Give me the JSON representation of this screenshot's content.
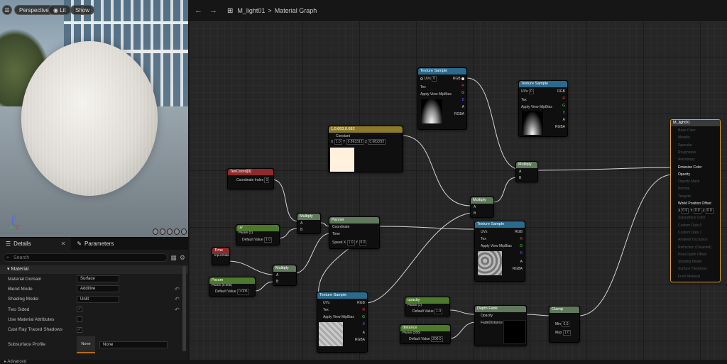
{
  "viewport": {
    "perspective": "Perspective",
    "lit": "Lit",
    "show": "Show"
  },
  "breadcrumb": {
    "asset": "M_light01",
    "separator": ">",
    "graph": "Material Graph"
  },
  "details": {
    "tab_details": "Details",
    "tab_parameters": "Parameters",
    "search_placeholder": "Search",
    "section": "Material",
    "rows": [
      {
        "label": "Material Domain",
        "value": "Surface"
      },
      {
        "label": "Blend Mode",
        "value": "Additive"
      },
      {
        "label": "Shading Model",
        "value": "Unlit"
      },
      {
        "label": "Two Sided",
        "value": "checked"
      },
      {
        "label": "Use Material Attributes",
        "value": ""
      },
      {
        "label": "Cast Ray Traced Shadows",
        "value": "checked"
      },
      {
        "label": "Subsurface Profile",
        "value": "None"
      }
    ],
    "subsurface_thumb": "None",
    "advanced": "Advanced"
  },
  "nodes": {
    "tex_top": {
      "title": "Texture Sample",
      "uvs": "UVs",
      "tex": "Tex",
      "mip": "Apply View MipBias",
      "rgb": "RGB",
      "r": "R",
      "g": "G",
      "b": "B",
      "a": "A",
      "rgba": "RGBA"
    },
    "tex_right": {
      "title": "Texture Sample",
      "uvs": "UVs",
      "tex": "Tex",
      "mip": "Apply View MipBias",
      "rgb": "RGB",
      "r": "R",
      "g": "G",
      "b": "B",
      "a": "A",
      "rgba": "RGBA",
      "uv_val": "0"
    },
    "uv_top": "0",
    "const": {
      "title": "1,0.863,0.682",
      "label": "Constant",
      "x": "1.0",
      "y": "0.863312",
      "z": "0.682292",
      "x_l": "X",
      "y_l": "Y",
      "z_l": "Z"
    },
    "texcoord": {
      "title": "TexCoord[0]",
      "label": "Coordinate Index",
      "val": "0"
    },
    "mult1": {
      "title": "Multiply",
      "a": "A",
      "b": "B"
    },
    "mult2": {
      "title": "Multiply",
      "a": "A",
      "b": "B"
    },
    "mult3": {
      "title": "Multiply",
      "a": "A",
      "b": "B"
    },
    "mult4": {
      "title": "Multiply",
      "a": "A",
      "b": "B"
    },
    "uv": {
      "title": "uv",
      "sub": "Param (1)",
      "label": "Default Value",
      "val": "1.0"
    },
    "time": {
      "title": "Time",
      "sub": "Input Data"
    },
    "param": {
      "title": "Param",
      "sub": "Param (0.005)",
      "label": "Default Value",
      "val": "0.005"
    },
    "panner": {
      "title": "Panner",
      "coord": "Coordinate",
      "time": "Time",
      "speed": "Speed",
      "x": "1.0",
      "y": "0.0",
      "x_l": "X",
      "y_l": "Y"
    },
    "tex_mid": {
      "title": "Texture Sample",
      "uvs": "UVs",
      "tex": "Tex",
      "mip": "Apply View MipBias",
      "rgb": "RGB",
      "r": "R",
      "g": "G",
      "b": "B",
      "a": "A",
      "rgba": "RGBA"
    },
    "tex_bot": {
      "title": "Texture Sample",
      "uvs": "UVs",
      "tex": "Tex",
      "mip": "Apply View MipBias",
      "rgb": "RGB",
      "r": "R",
      "g": "G",
      "b": "B",
      "a": "A",
      "rgba": "RGBA"
    },
    "opacity": {
      "title": "opacity",
      "sub": "Param (1)",
      "label": "Default Value",
      "val": "1.0"
    },
    "distance": {
      "title": "distance",
      "sub": "Param (200)",
      "label": "Default Value",
      "val": "200.0"
    },
    "depthfade": {
      "title": "Depth Fade",
      "opacity": "Opacity",
      "fade": "FadeDistance"
    },
    "clamp": {
      "title": "Clamp",
      "min": "Min",
      "max": "Max",
      "min_v": "0.0",
      "max_v": "1.0"
    },
    "result": {
      "title": "M_light01",
      "pins": [
        "Base Color",
        "Metallic",
        "Specular",
        "Roughness",
        "Anisotropy",
        "Emissive Color",
        "Opacity",
        "Opacity Mask",
        "Normal",
        "Tangent",
        "World Position Offset",
        "Subsurface Color",
        "Custom Data 0",
        "Custom Data 1",
        "Ambient Occlusion",
        "Refraction (Disabled)",
        "Pixel Depth Offset",
        "Shading Model",
        "Surface Thickness",
        "Front Material"
      ],
      "wpo": {
        "x": "0.0",
        "y": "0.0",
        "z": "0.0",
        "x_l": "X",
        "y_l": "Y",
        "z_l": "Z"
      }
    }
  },
  "colors": {
    "tex_header": "#2a6a8c",
    "mult_header": "#5e7a5a",
    "const_header": "#8a7a2a",
    "texcoord_header": "#8e2a2a",
    "param_header": "#4a7a2a",
    "result_border": "#d9a23a"
  }
}
